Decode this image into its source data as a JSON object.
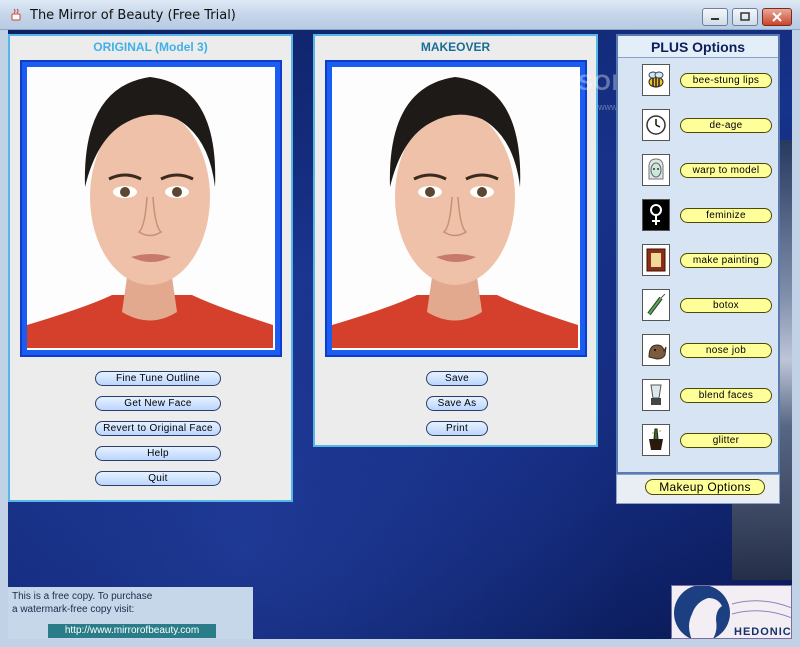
{
  "window": {
    "title": "The Mirror of Beauty (Free Trial)"
  },
  "original": {
    "title": "ORIGINAL (Model 3)",
    "buttons": [
      "Fine Tune Outline",
      "Get New Face",
      "Revert to Original Face",
      "Help",
      "Quit"
    ]
  },
  "makeover": {
    "title": "MAKEOVER",
    "buttons": [
      "Save",
      "Save As",
      "Print"
    ]
  },
  "plus": {
    "title": "PLUS Options",
    "items": [
      {
        "label": "bee-stung lips",
        "icon": "bee-icon"
      },
      {
        "label": "de-age",
        "icon": "clock-icon"
      },
      {
        "label": "warp to model",
        "icon": "model-face-icon"
      },
      {
        "label": "feminize",
        "icon": "female-symbol-icon"
      },
      {
        "label": "make painting",
        "icon": "painting-frame-icon"
      },
      {
        "label": "botox",
        "icon": "syringe-icon"
      },
      {
        "label": "nose job",
        "icon": "rhino-icon"
      },
      {
        "label": "blend faces",
        "icon": "blender-icon"
      },
      {
        "label": "glitter",
        "icon": "champagne-icon"
      }
    ],
    "makeup_button": "Makeup Options"
  },
  "footer": {
    "line1": "This is a free copy.  To purchase",
    "line2": "a watermark-free copy visit:",
    "url": "http://www.mirrorofbeauty.com"
  },
  "watermark": {
    "brand": "SOFTPEDIA",
    "url": "www.softpedia.com"
  },
  "logo": {
    "text": "HEDONICS"
  },
  "colors": {
    "panel_border": "#55b6ea",
    "original_title": "#3fb0e8",
    "makeover_title": "#1a6d97",
    "photo_frame": "#1b5df2",
    "button_fill": "#bcd6ff",
    "option_button_fill": "#ffff9a",
    "background": "#17328a"
  }
}
